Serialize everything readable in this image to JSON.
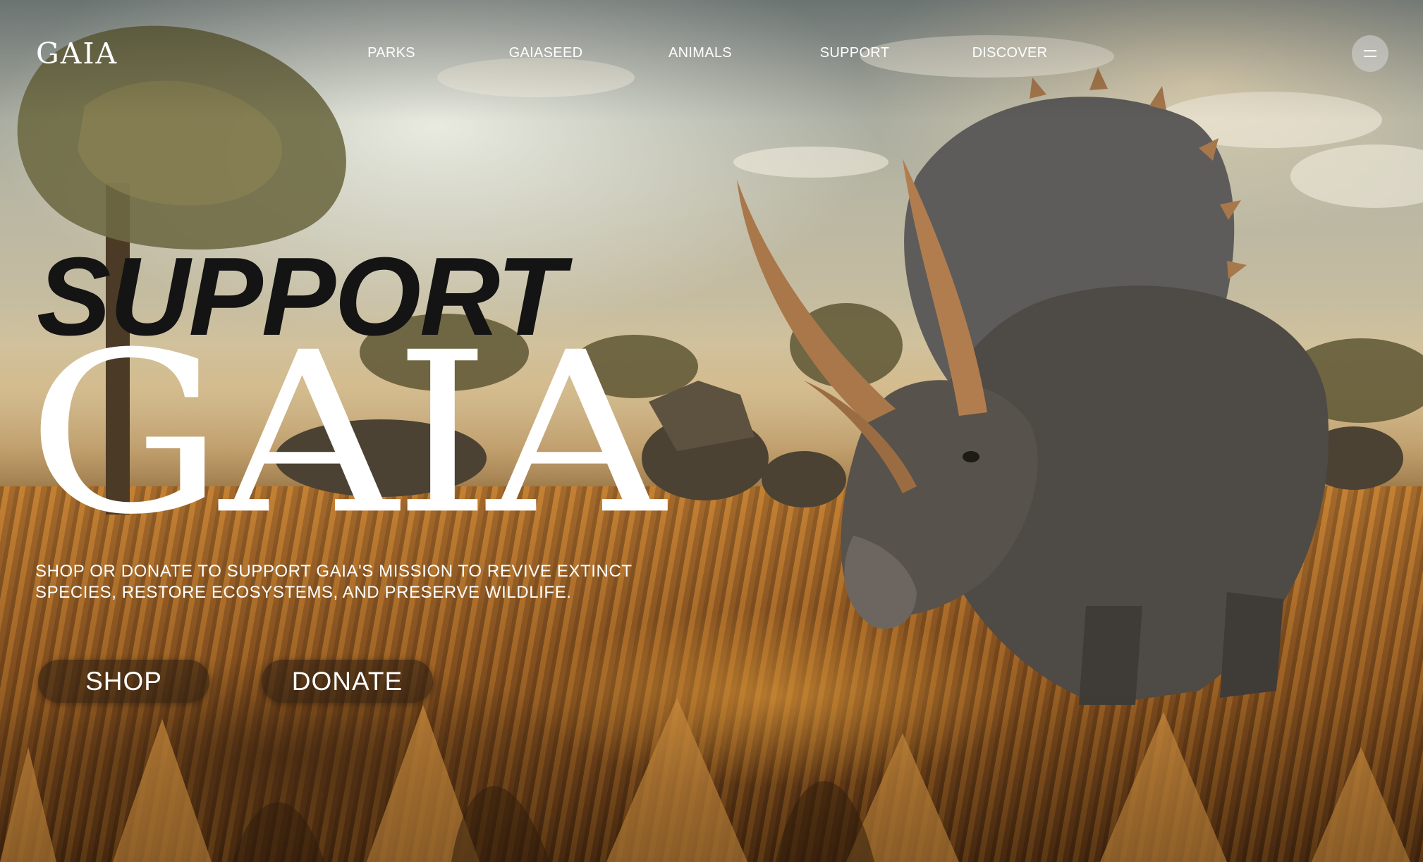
{
  "logo": "GAIA",
  "nav": {
    "links": [
      "PARKS",
      "GAIASEED",
      "ANIMALS",
      "SUPPORT",
      "DISCOVER"
    ],
    "menu_icon": "hamburger-menu-icon"
  },
  "hero": {
    "eyebrow": "SUPPORT",
    "title": "GAIA",
    "description": "SHOP OR DONATE TO SUPPORT GAIA'S MISSION TO REVIVE EXTINCT SPECIES, RESTORE ECOSYSTEMS, AND PRESERVE WILDLIFE.",
    "buttons": {
      "shop": "SHOP",
      "donate": "DONATE"
    }
  },
  "colors": {
    "eyebrow_text": "#141414",
    "title_text": "#ffffff",
    "button_bg": "rgba(40,28,16,0.55)"
  }
}
